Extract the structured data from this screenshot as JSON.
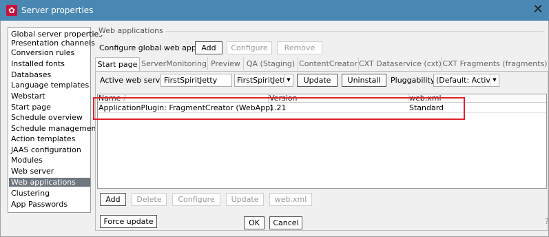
{
  "window": {
    "title": "Server properties",
    "app_icon": "gear-icon",
    "close_glyph": "✕"
  },
  "nav": {
    "items": [
      "Global server properties",
      "Presentation channels",
      "Conversion rules",
      "Installed fonts",
      "Databases",
      "Language templates",
      "Webstart",
      "Start page",
      "Schedule overview",
      "Schedule management",
      "Action templates",
      "JAAS configuration",
      "Modules",
      "Web server",
      "Web applications",
      "Clustering",
      "App Passwords"
    ],
    "selected": "Web applications"
  },
  "group": {
    "title": "Web applications",
    "configure_label": "Configure global web apps:",
    "buttons": {
      "add": "Add",
      "configure": "Configure",
      "remove": "Remove"
    }
  },
  "tabs": [
    "Start page",
    "ServerMonitoring",
    "Preview",
    "QA (Staging)",
    "ContentCreator",
    "CXT Dataservice (cxt)",
    "CXT Fragments (fragments)"
  ],
  "active_tab": "Start page",
  "server_row": {
    "label": "Active web server:",
    "value": "FirstSpiritJetty",
    "combo_value": "FirstSpiritJetty",
    "update": "Update",
    "uninstall": "Uninstall",
    "pluggability_label": "Pluggability:",
    "pluggability_value": "(Default: Active)"
  },
  "table": {
    "columns": [
      "Name",
      "Version",
      "web.xml"
    ],
    "sort_indicator": "/",
    "rows": [
      {
        "name": "ApplicationPlugin: FragmentCreator (WebApp)",
        "version": "1.21",
        "webxml": "Standard"
      }
    ]
  },
  "bottom_buttons": {
    "add": "Add",
    "delete": "Delete",
    "configure": "Configure",
    "update": "Update",
    "webxml": "web.xml",
    "force_update": "Force update"
  },
  "dialog_buttons": {
    "ok": "OK",
    "cancel": "Cancel"
  },
  "help_glyph": "?",
  "colors": {
    "titlebar": "#4a88b3",
    "selection": "#6f7780",
    "highlight": "#e0202c",
    "app_icon": "#c8103a"
  }
}
